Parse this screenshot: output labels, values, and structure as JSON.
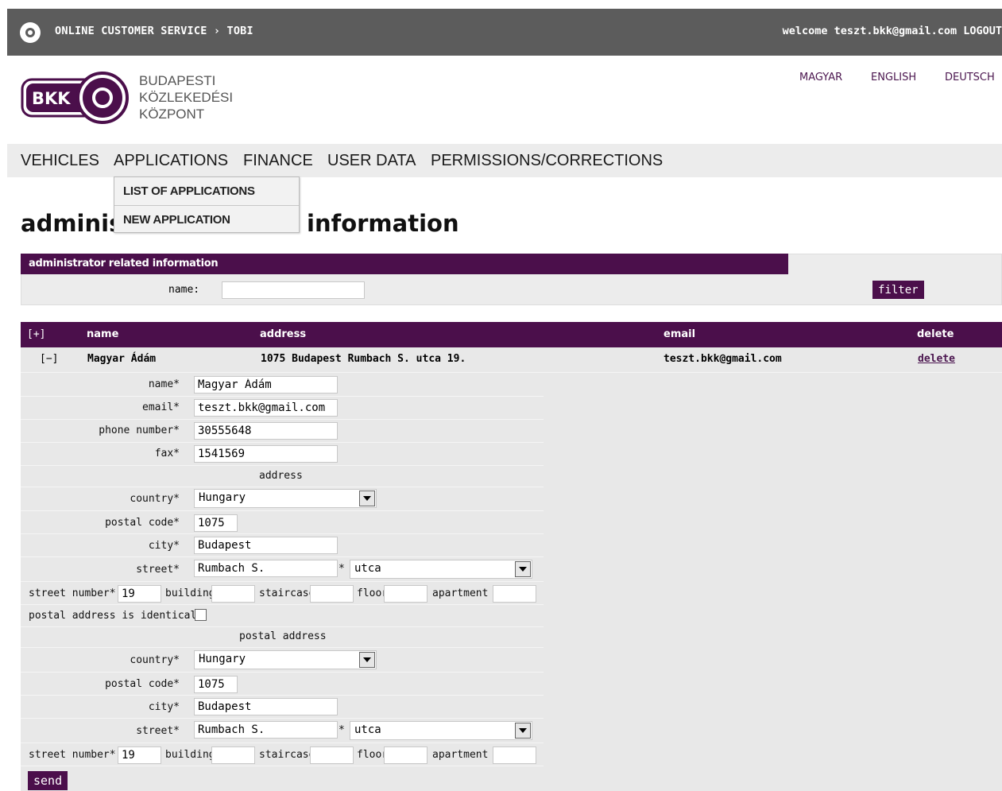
{
  "topbar": {
    "breadcrumb": "ONLINE CUSTOMER SERVICE › TOBI",
    "welcome": "welcome teszt.bkk@gmail.com LOGOUT"
  },
  "logo": {
    "mark": "BKK",
    "line1": "BUDAPESTI",
    "line2": "KÖZLEKEDÉSI",
    "line3": "KÖZPONT"
  },
  "languages": [
    "MAGYAR",
    "ENGLISH",
    "DEUTSCH"
  ],
  "nav": [
    "VEHICLES",
    "APPLICATIONS",
    "FINANCE",
    "USER DATA",
    "PERMISSIONS/CORRECTIONS"
  ],
  "dropdown": [
    "LIST OF APPLICATIONS",
    "NEW APPLICATION"
  ],
  "title": {
    "left": "adminis",
    "right": "information"
  },
  "filter": {
    "header": "administrator related information",
    "name_label": "name:",
    "name_value": "",
    "button": "filter"
  },
  "table": {
    "headers": {
      "toggle": "[+]",
      "name": "name",
      "address": "address",
      "email": "email",
      "delete": "delete"
    },
    "row": {
      "toggle": "[−]",
      "name": "Magyar Ádám",
      "address": "1075 Budapest Rumbach S. utca 19.",
      "email": "teszt.bkk@gmail.com",
      "delete": "delete"
    }
  },
  "form": {
    "labels": {
      "name": "name*",
      "email": "email*",
      "phone": "phone number*",
      "fax": "fax*",
      "address_section": "address",
      "country": "country*",
      "postal_code": "postal code*",
      "city": "city*",
      "street": "street*",
      "street_star": "*",
      "street_number": "street number*",
      "building": "building",
      "staircase": "staircase",
      "floor": "floor",
      "apartment": "apartment",
      "postal_identical": "postal address is identical",
      "postal_section": "postal address"
    },
    "values": {
      "name": "Magyar Ádám",
      "email": "teszt.bkk@gmail.com",
      "phone": "30555648",
      "fax": "1541569",
      "country": "Hungary",
      "postal_code": "1075",
      "city": "Budapest",
      "street": "Rumbach S.",
      "street_type": "utca",
      "street_number": "19",
      "building": "",
      "staircase": "",
      "floor": "",
      "apartment": "",
      "postal_identical": false,
      "p_country": "Hungary",
      "p_postal_code": "1075",
      "p_city": "Budapest",
      "p_street": "Rumbach S.",
      "p_street_type": "utca",
      "p_street_number": "19"
    },
    "send": "send"
  },
  "colors": {
    "brand": "#4b0f4b",
    "topbar": "#5c5c5c",
    "link": "#4b164f"
  }
}
